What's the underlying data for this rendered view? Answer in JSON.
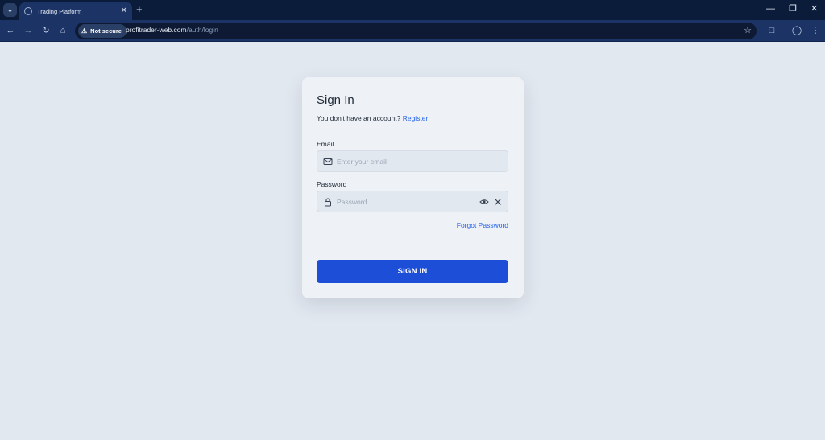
{
  "browser": {
    "tab_title": "Trading Platform",
    "security_badge": "Not secure",
    "url_host": "profitrader-web.com",
    "url_path": "/auth/login"
  },
  "login": {
    "heading": "Sign In",
    "no_account_text": "You don't have an account?",
    "register_link": "Register",
    "email_label": "Email",
    "email_placeholder": "Enter your email",
    "email_value": "",
    "password_label": "Password",
    "password_placeholder": "Password",
    "password_value": "",
    "forgot_password_link": "Forgot Password",
    "submit_label": "SIGN IN"
  },
  "colors": {
    "page_background": "#e2e8f0",
    "card_background": "#eef2f7",
    "primary_button": "#1d4ed8",
    "link": "#2563eb",
    "browser_frame": "#0b1b3a"
  },
  "icons": {
    "email_field": "mail-icon",
    "password_field": "lock-icon",
    "toggle_visibility": "eye-icon",
    "clear_field": "close-icon"
  }
}
